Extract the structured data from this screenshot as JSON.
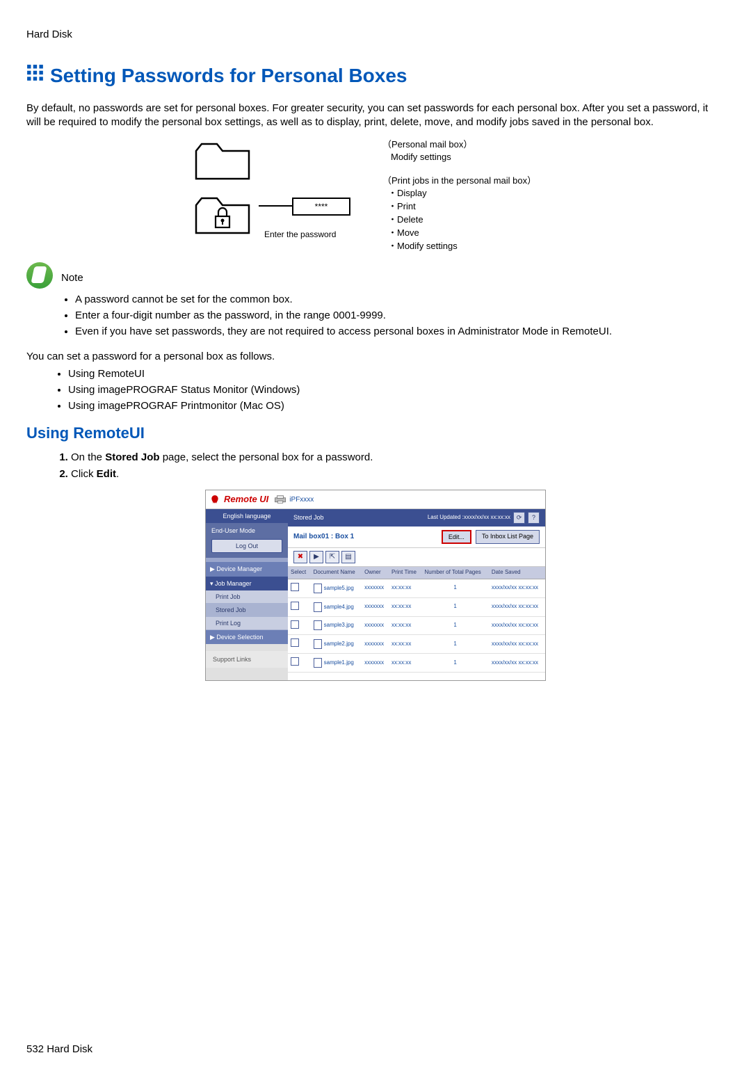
{
  "header": "Hard Disk",
  "title": "Setting Passwords for Personal Boxes",
  "intro": "By default, no passwords are set for personal boxes. For greater security, you can set passwords for each personal box. After you set a password, it will be required to modify the personal box settings, as well as to display, print, delete, move, and modify jobs saved in the personal box.",
  "diagram": {
    "pwd_stars": "****",
    "pwd_label": "Enter the password",
    "col1_hdr": "（Personal mail box）",
    "col1_line": "Modify settings",
    "col2_hdr": "（Print jobs in the personal mail box）",
    "col2_items": [
      "・Display",
      "・Print",
      "・Delete",
      "・Move",
      "・Modify settings"
    ]
  },
  "note": {
    "label": "Note",
    "items": [
      "A password cannot be set for the common box.",
      "Enter a four-digit number as the password, in the range 0001-9999.",
      "Even if you have set passwords, they are not required to access personal boxes in Administrator Mode in RemoteUI."
    ]
  },
  "after_note": "You can set a password for a personal box as follows.",
  "methods": [
    "Using RemoteUI",
    "Using imagePROGRAF Status Monitor (Windows)",
    "Using imagePROGRAF Printmonitor (Mac OS)"
  ],
  "section": "Using RemoteUI",
  "steps": [
    {
      "pre": "On the ",
      "bold": "Stored Job",
      "post": " page, select the personal box for a password."
    },
    {
      "pre": "Click ",
      "bold": "Edit",
      "post": "."
    }
  ],
  "ui": {
    "brand": "Remote UI",
    "printer": "iPFxxxx",
    "side": {
      "lang": "English language",
      "mode": "End-User Mode",
      "logout": "Log Out",
      "cat1": "Device Manager",
      "cat2": "Job Manager",
      "items": [
        "Print Job",
        "Stored Job",
        "Print Log"
      ],
      "cat3": "Device Selection",
      "support": "Support Links"
    },
    "main": {
      "hdr": "Stored Job",
      "last_updated": "Last Updated :xxxx/xx/xx xx:xx:xx",
      "sub": "Mail box01 : Box 1",
      "edit": "Edit...",
      "inbox": "To Inbox List Page",
      "cols": [
        "Select",
        "Document Name",
        "Owner",
        "Print Time",
        "Number of Total Pages",
        "Date Saved"
      ],
      "rows": [
        {
          "name": "sample5.jpg",
          "owner": "xxxxxxx",
          "time": "xx:xx:xx",
          "pages": "1",
          "date": "xxxx/xx/xx xx:xx:xx"
        },
        {
          "name": "sample4.jpg",
          "owner": "xxxxxxx",
          "time": "xx:xx:xx",
          "pages": "1",
          "date": "xxxx/xx/xx xx:xx:xx"
        },
        {
          "name": "sample3.jpg",
          "owner": "xxxxxxx",
          "time": "xx:xx:xx",
          "pages": "1",
          "date": "xxxx/xx/xx xx:xx:xx"
        },
        {
          "name": "sample2.jpg",
          "owner": "xxxxxxx",
          "time": "xx:xx:xx",
          "pages": "1",
          "date": "xxxx/xx/xx xx:xx:xx"
        },
        {
          "name": "sample1.jpg",
          "owner": "xxxxxxx",
          "time": "xx:xx:xx",
          "pages": "1",
          "date": "xxxx/xx/xx xx:xx:xx"
        }
      ]
    }
  },
  "footer": "532  Hard Disk"
}
